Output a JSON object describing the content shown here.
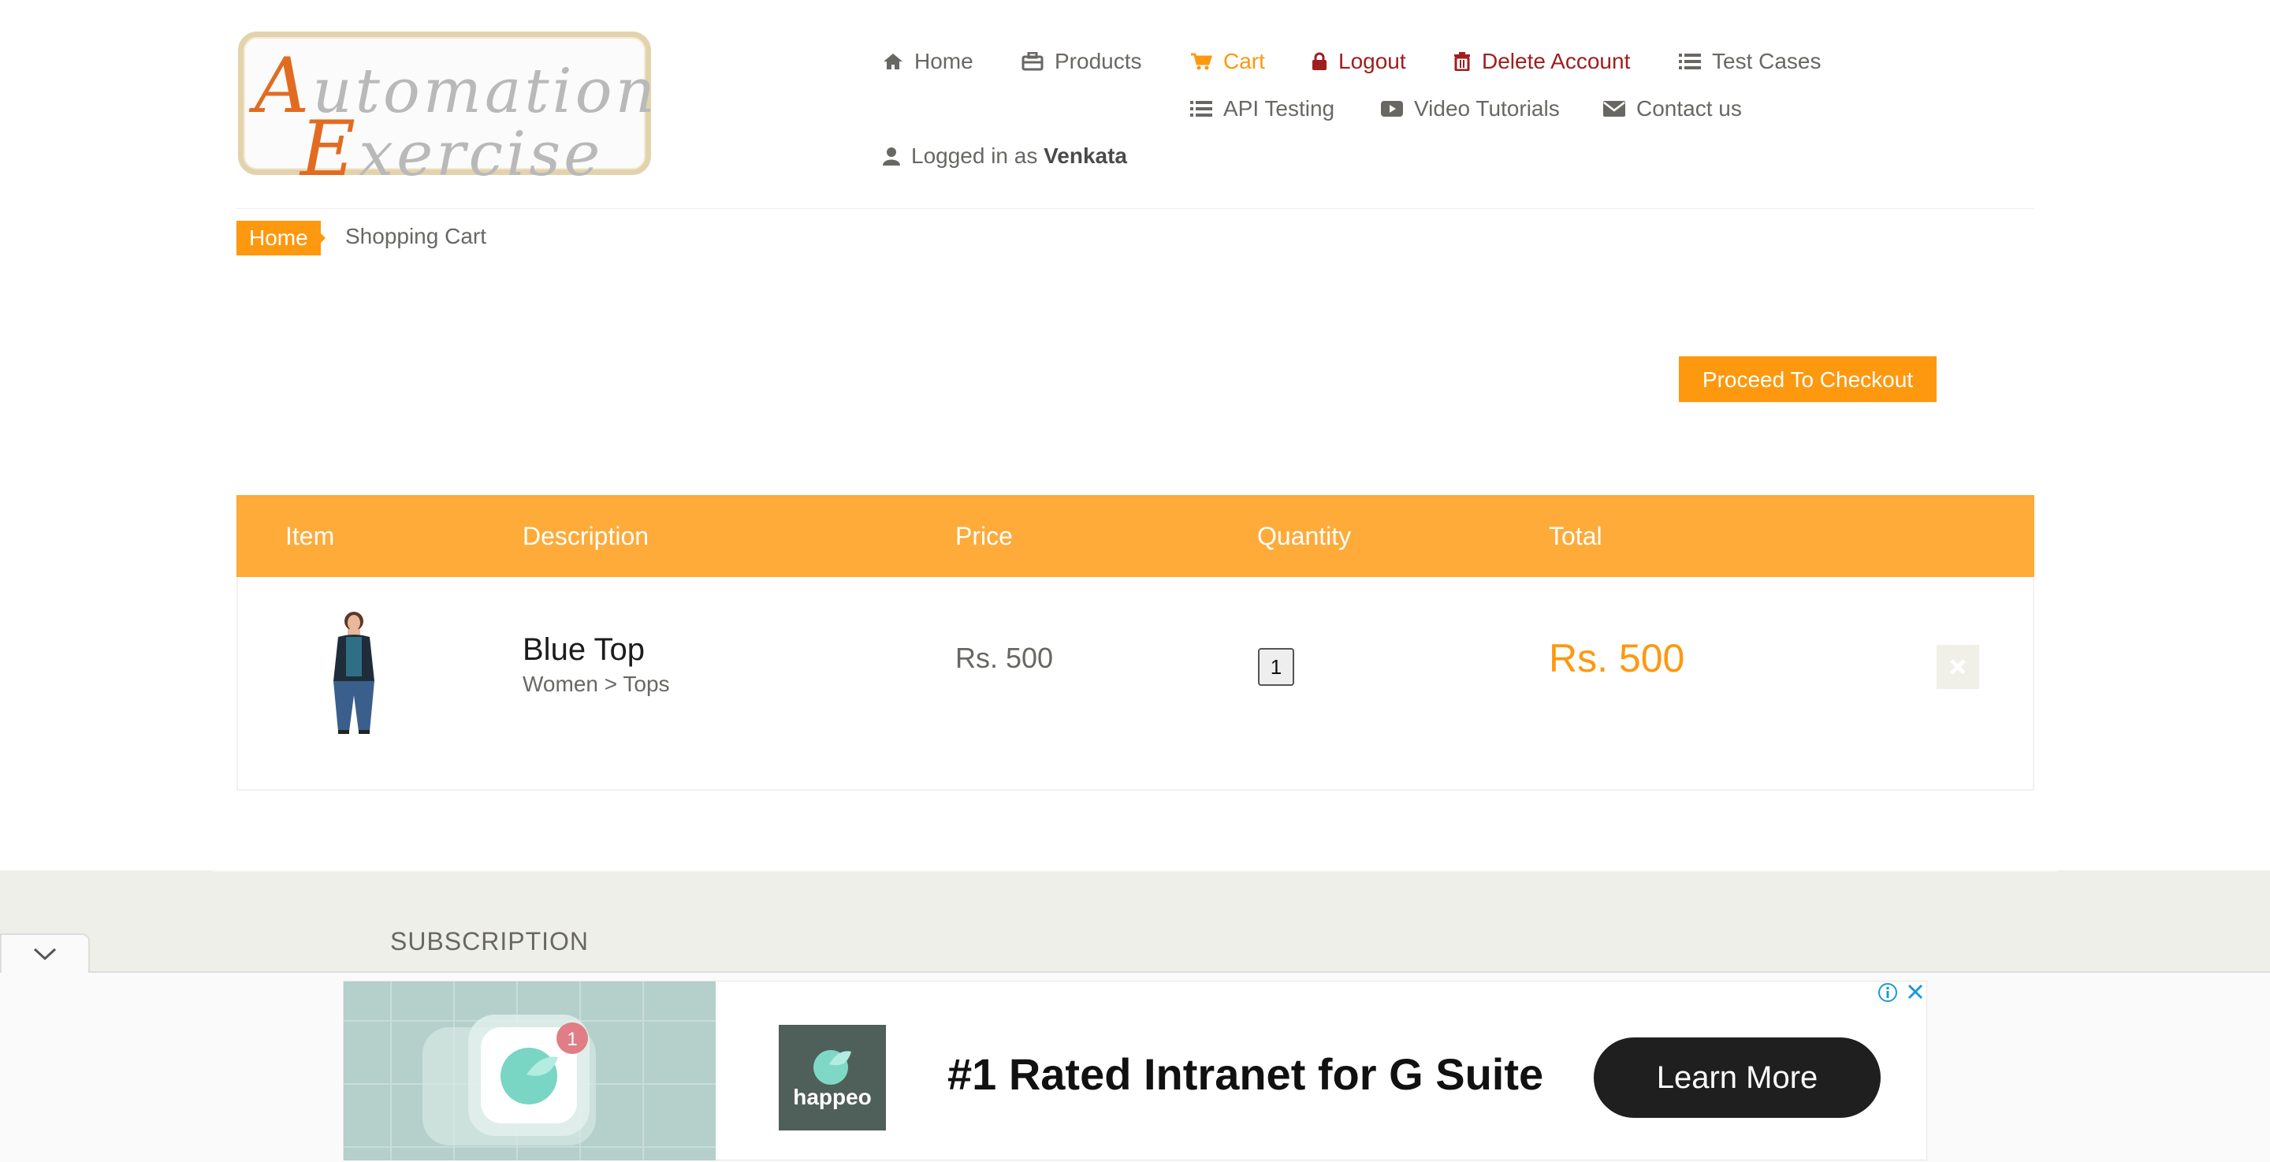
{
  "logo": {
    "line1": "Automation",
    "line2": "Exercise"
  },
  "nav": {
    "home": "Home",
    "products": "Products",
    "cart": "Cart",
    "logout": "Logout",
    "delete_account": "Delete Account",
    "test_cases": "Test Cases",
    "api_testing": "API Testing",
    "video_tutorials": "Video Tutorials",
    "contact_us": "Contact us",
    "logged_in_prefix": "Logged in as",
    "username": "Venkata"
  },
  "breadcrumb": {
    "home": "Home",
    "current": "Shopping Cart"
  },
  "checkout_button": "Proceed To Checkout",
  "cart": {
    "headers": [
      "Item",
      "Description",
      "Price",
      "Quantity",
      "Total"
    ],
    "rows": [
      {
        "name": "Blue Top",
        "category": "Women > Tops",
        "price": "Rs. 500",
        "quantity": "1",
        "total": "Rs. 500"
      }
    ]
  },
  "footer": {
    "subscription_title": "SUBSCRIPTION"
  },
  "ad": {
    "brand": "happeo",
    "headline": "#1 Rated Intranet for G Suite",
    "cta": "Learn More",
    "badge_count": "1"
  },
  "colors": {
    "accent": "#fe980f",
    "danger": "#a01e1e",
    "text": "#696763",
    "footer_bg": "#efefe9"
  }
}
